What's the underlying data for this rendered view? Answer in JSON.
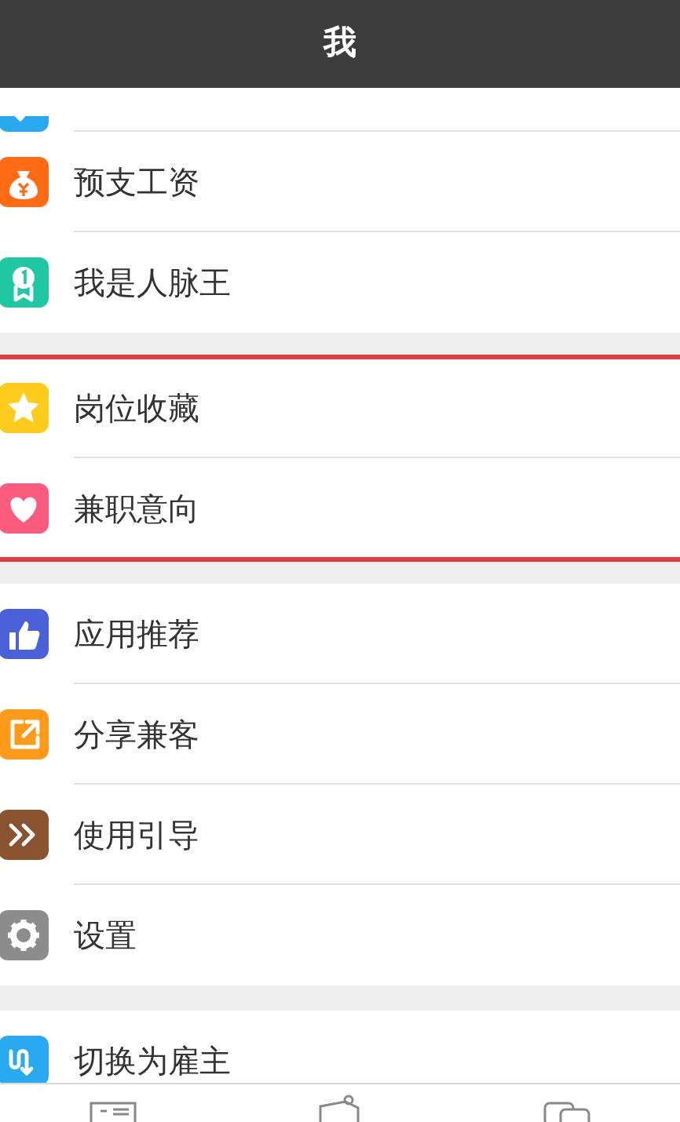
{
  "header": {
    "title": "我"
  },
  "groups": [
    {
      "highlighted": false,
      "items": [
        {
          "kind": "service",
          "color": "#29a9f0",
          "partial": true
        },
        {
          "kind": "money",
          "label": "预支工资",
          "color": "#ff6a13"
        },
        {
          "kind": "medal",
          "label": "我是人脉王",
          "color": "#1fc8a2"
        }
      ]
    },
    {
      "highlighted": true,
      "items": [
        {
          "kind": "star",
          "label": "岗位收藏",
          "color": "#ffcc1e"
        },
        {
          "kind": "heart",
          "label": "兼职意向",
          "color": "#fb5b7c"
        }
      ]
    },
    {
      "highlighted": false,
      "items": [
        {
          "kind": "thumb",
          "label": "应用推荐",
          "color": "#4a61d8"
        },
        {
          "kind": "share",
          "label": "分享兼客",
          "color": "#ff9a1a"
        },
        {
          "kind": "guide",
          "label": "使用引导",
          "color": "#8a5431"
        },
        {
          "kind": "gear",
          "label": "设置",
          "color": "#8c8c8c"
        }
      ]
    },
    {
      "highlighted": false,
      "items": [
        {
          "kind": "switch",
          "label": "切换为雇主",
          "color": "#29a9f0"
        }
      ]
    }
  ],
  "tabbar": [
    {
      "kind": "card"
    },
    {
      "kind": "pin"
    },
    {
      "kind": "chat"
    }
  ]
}
